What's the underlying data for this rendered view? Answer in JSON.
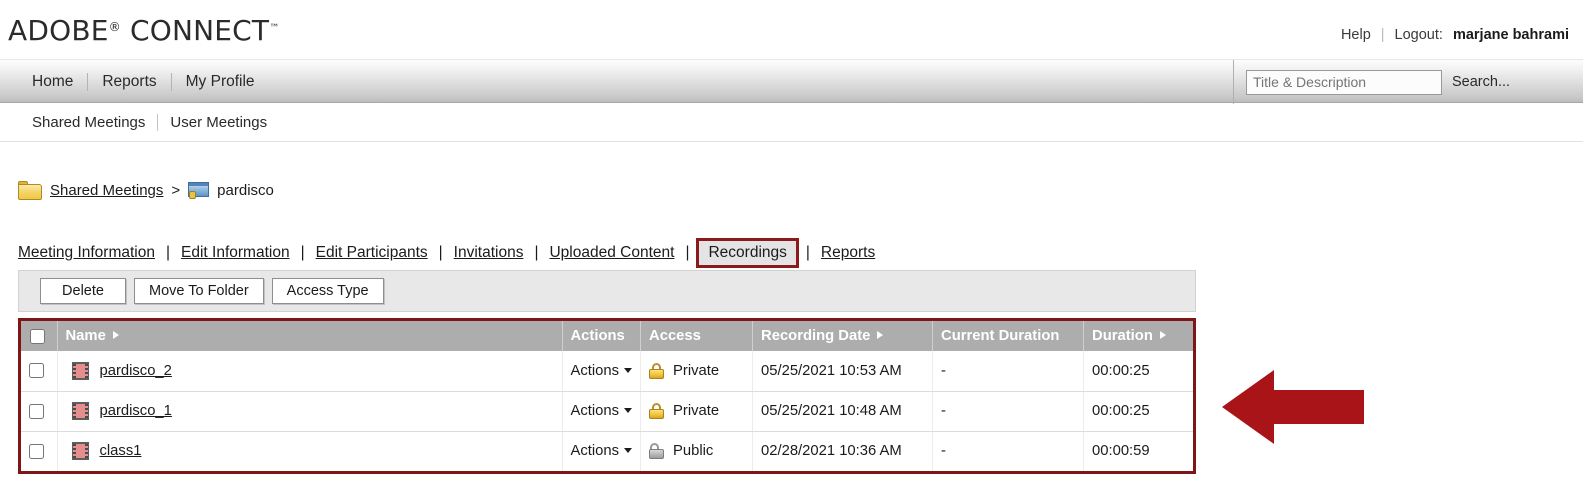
{
  "brand": {
    "name": "ADOBE",
    "registered": "®",
    "product": "CONNECT",
    "trademark": "™"
  },
  "header": {
    "help_label": "Help",
    "separator": "|",
    "logout_label": "Logout:",
    "user_name": "marjane bahrami"
  },
  "navbar": {
    "items": [
      {
        "label": "Home",
        "name": "nav-home"
      },
      {
        "label": "Reports",
        "name": "nav-reports"
      },
      {
        "label": "My Profile",
        "name": "nav-my-profile"
      }
    ],
    "search": {
      "placeholder": "Title & Description",
      "value": "",
      "button_label": "Search..."
    }
  },
  "subnav": {
    "items": [
      {
        "label": "Shared Meetings"
      },
      {
        "label": "User Meetings"
      }
    ]
  },
  "breadcrumb": {
    "folder_icon": "folder-icon",
    "root_label": "Shared Meetings",
    "separator": ">",
    "meeting_icon": "meeting-icon",
    "current_label": "pardisco"
  },
  "tabs": {
    "items": [
      {
        "label": "Meeting Information",
        "active": false
      },
      {
        "label": "Edit Information",
        "active": false
      },
      {
        "label": "Edit Participants",
        "active": false
      },
      {
        "label": "Invitations",
        "active": false
      },
      {
        "label": "Uploaded Content",
        "active": false
      },
      {
        "label": "Recordings",
        "active": true
      },
      {
        "label": "Reports",
        "active": false
      }
    ],
    "pipe": "|",
    "highlight_color": "#8b1a1a"
  },
  "toolbar": {
    "delete_label": "Delete",
    "move_to_folder_label": "Move To Folder",
    "access_type_label": "Access Type"
  },
  "table": {
    "border_color": "#7e1618",
    "header_bg": "#adadad",
    "columns": [
      {
        "key": "checkbox",
        "label": "",
        "sortable": false
      },
      {
        "key": "name",
        "label": "Name",
        "sortable": true
      },
      {
        "key": "actions",
        "label": "Actions",
        "sortable": false
      },
      {
        "key": "access",
        "label": "Access",
        "sortable": false
      },
      {
        "key": "recording_date",
        "label": "Recording Date",
        "sortable": true
      },
      {
        "key": "current_duration",
        "label": "Current Duration",
        "sortable": false
      },
      {
        "key": "duration",
        "label": "Duration",
        "sortable": true
      }
    ],
    "rows": [
      {
        "checked": false,
        "icon": "recording-film-icon",
        "name": "pardisco_2",
        "actions_label": "Actions",
        "access": "Private",
        "access_icon": "lock-closed-icon",
        "recording_date": "05/25/2021 10:53 AM",
        "current_duration": "-",
        "duration": "00:00:25"
      },
      {
        "checked": false,
        "icon": "recording-film-icon",
        "name": "pardisco_1",
        "actions_label": "Actions",
        "access": "Private",
        "access_icon": "lock-closed-icon",
        "recording_date": "05/25/2021 10:48 AM",
        "current_duration": "-",
        "duration": "00:00:25"
      },
      {
        "checked": false,
        "icon": "recording-film-icon",
        "name": "class1",
        "actions_label": "Actions",
        "access": "Public",
        "access_icon": "lock-open-icon",
        "recording_date": "02/28/2021 10:36 AM",
        "current_duration": "-",
        "duration": "00:00:59"
      }
    ]
  },
  "annotation": {
    "arrow": {
      "name": "left-pointing-arrow-annotation",
      "direction": "left",
      "color": "#a91418"
    }
  }
}
